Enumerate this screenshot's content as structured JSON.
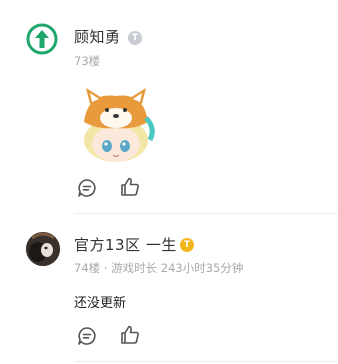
{
  "posts": [
    {
      "username": "顾知勇",
      "badge_letter": "T",
      "badge_color": "#c9ccd3",
      "meta": "73楼",
      "sticker": "shiba-girl-sticker"
    },
    {
      "username": "官方13区 一生",
      "badge_letter": "T",
      "badge_color": "#f2b51c",
      "meta": "74楼 · 游戏时长 243小时35分钟",
      "content": "还没更新"
    }
  ],
  "colors": {
    "avatar_green": "#1fa66a",
    "divider": "#ececec"
  },
  "icons": [
    "comment-icon",
    "like-icon"
  ]
}
